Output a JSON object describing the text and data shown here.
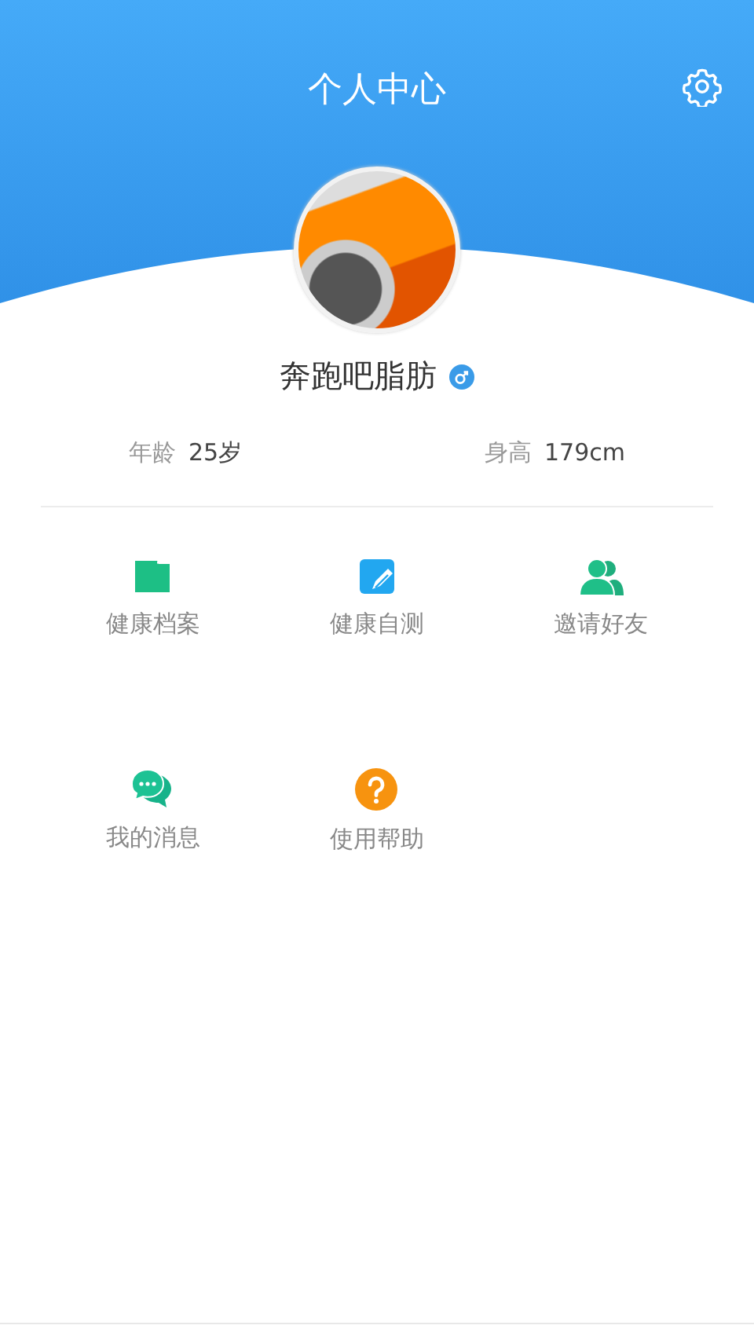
{
  "header": {
    "title": "个人中心"
  },
  "profile": {
    "name": "奔跑吧脂肪"
  },
  "stats": [
    {
      "label": "年龄",
      "value": "25岁"
    },
    {
      "label": "身高",
      "value": "179cm"
    }
  ],
  "menu": [
    {
      "kind": "folder",
      "label": "健康档案"
    },
    {
      "kind": "edit",
      "label": "健康自测"
    },
    {
      "kind": "friends",
      "label": "邀请好友"
    },
    {
      "kind": "chat",
      "label": "我的消息"
    },
    {
      "kind": "help",
      "label": "使用帮助"
    }
  ]
}
